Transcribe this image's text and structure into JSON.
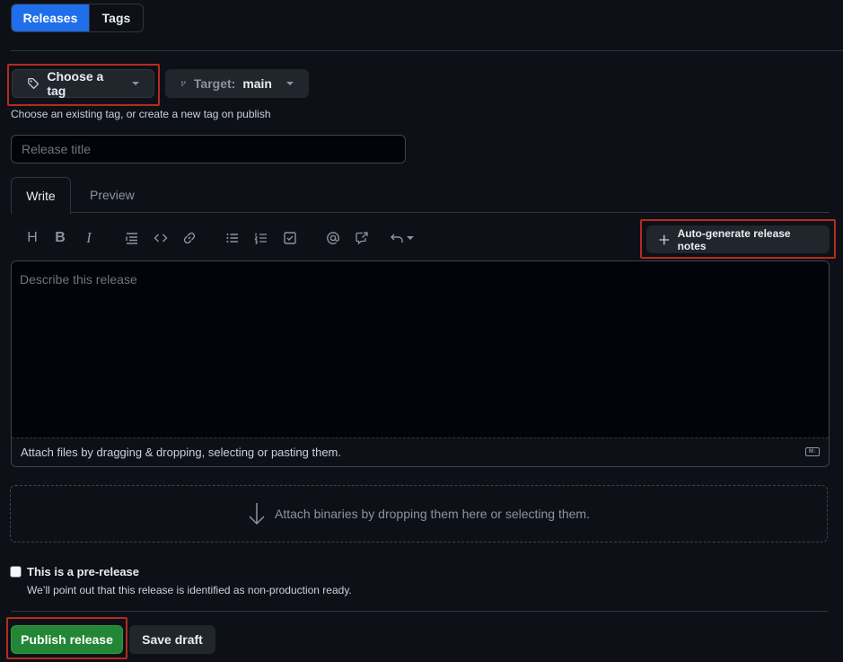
{
  "nav": {
    "releases_tab": "Releases",
    "tags_tab": "Tags"
  },
  "tag_picker": {
    "label": "Choose a tag",
    "icon": "tag-icon"
  },
  "target": {
    "label": "Target:",
    "branch": "main",
    "icon": "git-branch-icon"
  },
  "tag_hint": "Choose an existing tag, or create a new tag on publish",
  "release_title": {
    "placeholder": "Release title",
    "value": ""
  },
  "editor_tabs": {
    "write": "Write",
    "preview": "Preview"
  },
  "toolbar": {
    "icons": [
      "heading-icon",
      "bold-icon",
      "italic-icon",
      "quote-icon",
      "code-icon",
      "link-icon",
      "unordered-list-icon",
      "ordered-list-icon",
      "task-list-icon",
      "mention-icon",
      "reference-icon",
      "undo-icon"
    ],
    "auto_generate_label": "Auto-generate release notes"
  },
  "editor": {
    "placeholder": "Describe this release",
    "attach_hint": "Attach files by dragging & dropping, selecting or pasting them.",
    "markdown_badge": "M↓"
  },
  "binaries": {
    "label": "Attach binaries by dropping them here or selecting them."
  },
  "prerelease": {
    "label": "This is a pre-release",
    "description": "We’ll point out that this release is identified as non-production ready.",
    "checked": false
  },
  "actions": {
    "publish": "Publish release",
    "save_draft": "Save draft"
  },
  "colors": {
    "accent": "#1f6feb",
    "publish": "#238636",
    "highlight": "#b62a1f",
    "background": "#0d1117"
  }
}
